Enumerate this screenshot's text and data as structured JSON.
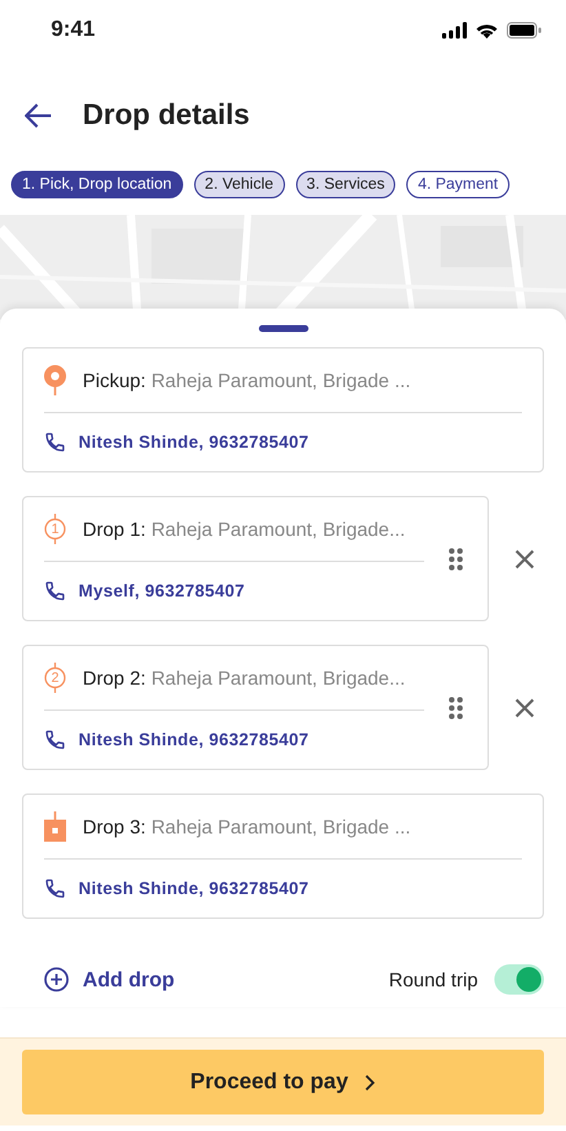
{
  "status_bar": {
    "time": "9:41"
  },
  "header": {
    "title": "Drop details"
  },
  "steps": [
    {
      "label": "1. Pick, Drop location",
      "selected": true,
      "done": false
    },
    {
      "label": "2. Vehicle",
      "selected": false,
      "done": true
    },
    {
      "label": "3. Services",
      "selected": false,
      "done": true
    },
    {
      "label": "4. Payment",
      "selected": false,
      "done": false
    }
  ],
  "stops": [
    {
      "kind": "pickup",
      "label": "Pickup:",
      "address": "Raheja Paramount, Brigade ...",
      "contact": "Nitesh Shinde, 9632785407",
      "movable": false
    },
    {
      "kind": "drop",
      "marker": "1",
      "label": "Drop 1:",
      "address": "Raheja Paramount, Brigade...",
      "contact": "Myself, 9632785407",
      "movable": true
    },
    {
      "kind": "drop",
      "marker": "2",
      "label": "Drop 2:",
      "address": "Raheja Paramount, Brigade...",
      "contact": "Nitesh Shinde, 9632785407",
      "movable": true
    },
    {
      "kind": "final",
      "label": "Drop 3:",
      "address": "Raheja Paramount, Brigade ...",
      "contact": "Nitesh Shinde, 9632785407",
      "movable": false
    }
  ],
  "add_drop": {
    "label": "Add drop"
  },
  "round_trip": {
    "label": "Round trip",
    "on": true
  },
  "proceed_button": {
    "label": "Proceed to pay"
  }
}
